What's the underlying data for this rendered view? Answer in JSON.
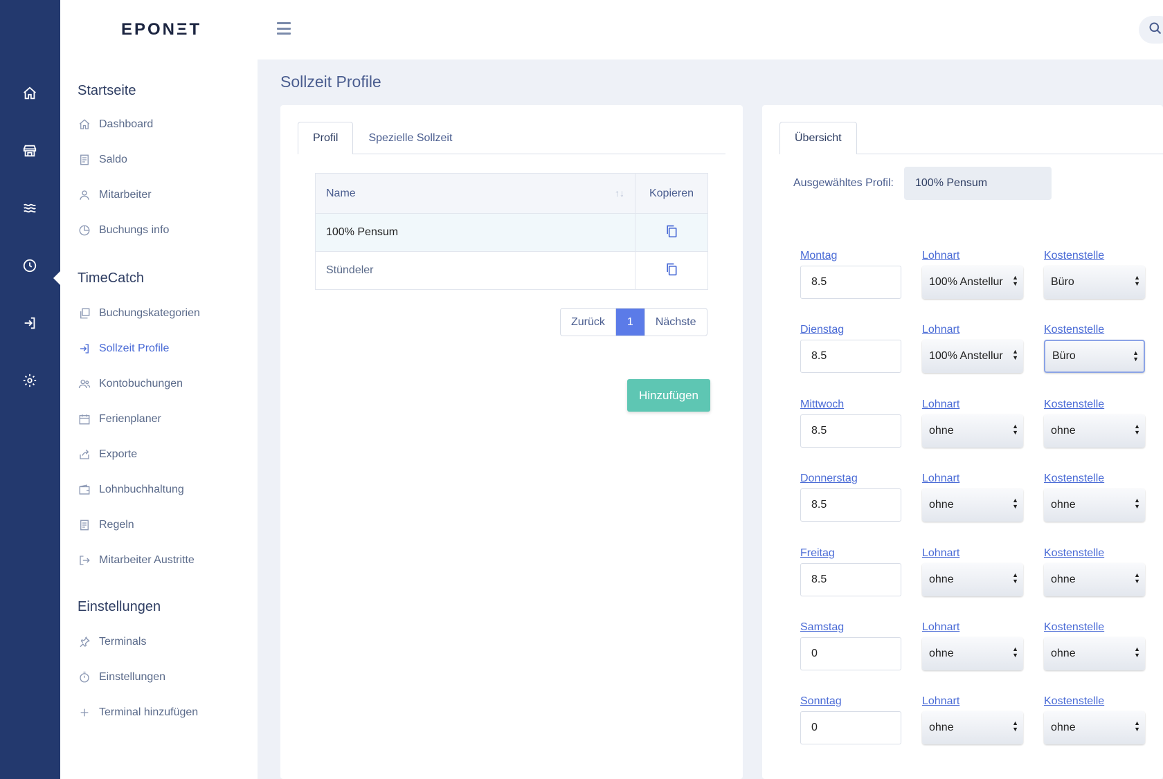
{
  "header": {
    "logo": "EPONΞT"
  },
  "rail": [
    "home-icon",
    "store-icon",
    "waves-icon",
    "clock-icon",
    "login-icon",
    "settings-icon"
  ],
  "sidebar": {
    "sections": [
      {
        "title": "Startseite",
        "items": [
          {
            "label": "Dashboard",
            "icon": "home-icon"
          },
          {
            "label": "Saldo",
            "icon": "document-icon"
          },
          {
            "label": "Mitarbeiter",
            "icon": "user-icon"
          },
          {
            "label": "Buchungs info",
            "icon": "pie-chart-icon"
          }
        ]
      },
      {
        "title": "TimeCatch",
        "items": [
          {
            "label": "Buchungskategorien",
            "icon": "copy-icon"
          },
          {
            "label": "Sollzeit Profile",
            "icon": "login-icon",
            "active": true
          },
          {
            "label": "Kontobuchungen",
            "icon": "users-icon"
          },
          {
            "label": "Ferienplaner",
            "icon": "calendar-icon"
          },
          {
            "label": "Exporte",
            "icon": "share-icon"
          },
          {
            "label": "Lohnbuchhaltung",
            "icon": "wallet-icon"
          },
          {
            "label": "Regeln",
            "icon": "document-icon"
          },
          {
            "label": "Mitarbeiter Austritte",
            "icon": "logout-icon"
          }
        ]
      },
      {
        "title": "Einstellungen",
        "items": [
          {
            "label": "Terminals",
            "icon": "pin-icon"
          },
          {
            "label": "Einstellungen",
            "icon": "timer-icon"
          },
          {
            "label": "Terminal hinzufügen",
            "icon": "plus-icon"
          }
        ]
      }
    ]
  },
  "page": {
    "title": "Sollzeit Profile"
  },
  "left_card": {
    "tabs": [
      "Profil",
      "Spezielle Sollzeit"
    ],
    "table": {
      "headers": [
        "Name",
        "Kopieren"
      ],
      "rows": [
        "100% Pensum",
        "Stündeler"
      ]
    },
    "pager": {
      "prev": "Zurück",
      "current": "1",
      "next": "Nächste"
    },
    "add_button": "Hinzufügen"
  },
  "right_card": {
    "tab": "Übersicht",
    "selected_label": "Ausgewähltes Profil:",
    "selected_value": "100% Pensum",
    "lohnart_label": "Lohnart",
    "kostenstelle_label": "Kostenstelle",
    "days": [
      {
        "day": "Montag",
        "hours": "8.5",
        "lohnart": "100% Anstellur",
        "kostenstelle": "Büro"
      },
      {
        "day": "Dienstag",
        "hours": "8.5",
        "lohnart": "100% Anstellur",
        "kostenstelle": "Büro"
      },
      {
        "day": "Mittwoch",
        "hours": "8.5",
        "lohnart": "ohne",
        "kostenstelle": "ohne"
      },
      {
        "day": "Donnerstag",
        "hours": "8.5",
        "lohnart": "ohne",
        "kostenstelle": "ohne"
      },
      {
        "day": "Freitag",
        "hours": "8.5",
        "lohnart": "ohne",
        "kostenstelle": "ohne"
      },
      {
        "day": "Samstag",
        "hours": "0",
        "lohnart": "ohne",
        "kostenstelle": "ohne"
      },
      {
        "day": "Sonntag",
        "hours": "0",
        "lohnart": "ohne",
        "kostenstelle": "ohne"
      }
    ]
  },
  "colors": {
    "rail": "#23396e",
    "accent": "#5b7be8",
    "add_button": "#5ec6b3",
    "active_link": "#4a6bd6"
  }
}
